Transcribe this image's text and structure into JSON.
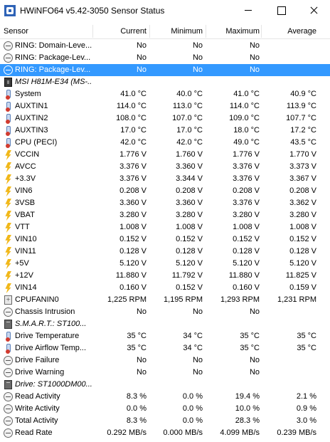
{
  "window": {
    "title": "HWiNFO64 v5.42-3050 Sensor Status"
  },
  "columns": {
    "sensor": "Sensor",
    "current": "Current",
    "minimum": "Minimum",
    "maximum": "Maximum",
    "average": "Average"
  },
  "colors": {
    "selection": "#3399ff",
    "bolt": "#f1b81a",
    "thermometer_bulb": "#d23b2f"
  },
  "rows": [
    {
      "icon": "clock-icon",
      "name": "RING: Domain-Leve...",
      "current": "No",
      "minimum": "No",
      "maximum": "No",
      "average": ""
    },
    {
      "icon": "clock-icon",
      "name": "RING: Package-Lev...",
      "current": "No",
      "minimum": "No",
      "maximum": "No",
      "average": ""
    },
    {
      "icon": "clock-icon",
      "name": "RING: Package-Lev...",
      "current": "No",
      "minimum": "No",
      "maximum": "No",
      "average": "",
      "selected": true
    },
    {
      "icon": "chip-icon",
      "name": "MSI H81M-E34 (MS-...",
      "group": true,
      "current": "",
      "minimum": "",
      "maximum": "",
      "average": ""
    },
    {
      "icon": "thermometer-icon",
      "name": "System",
      "current": "41.0 °C",
      "minimum": "40.0 °C",
      "maximum": "41.0 °C",
      "average": "40.9 °C"
    },
    {
      "icon": "thermometer-icon",
      "name": "AUXTIN1",
      "current": "114.0 °C",
      "minimum": "113.0 °C",
      "maximum": "114.0 °C",
      "average": "113.9 °C"
    },
    {
      "icon": "thermometer-icon",
      "name": "AUXTIN2",
      "current": "108.0 °C",
      "minimum": "107.0 °C",
      "maximum": "109.0 °C",
      "average": "107.7 °C"
    },
    {
      "icon": "thermometer-icon",
      "name": "AUXTIN3",
      "current": "17.0 °C",
      "minimum": "17.0 °C",
      "maximum": "18.0 °C",
      "average": "17.2 °C"
    },
    {
      "icon": "thermometer-icon",
      "name": "CPU (PECI)",
      "current": "42.0 °C",
      "minimum": "42.0 °C",
      "maximum": "49.0 °C",
      "average": "43.5 °C"
    },
    {
      "icon": "lightning-icon",
      "name": "VCCIN",
      "current": "1.776 V",
      "minimum": "1.760 V",
      "maximum": "1.776 V",
      "average": "1.770 V"
    },
    {
      "icon": "lightning-icon",
      "name": "AVCC",
      "current": "3.376 V",
      "minimum": "3.360 V",
      "maximum": "3.376 V",
      "average": "3.373 V"
    },
    {
      "icon": "lightning-icon",
      "name": "+3.3V",
      "current": "3.376 V",
      "minimum": "3.344 V",
      "maximum": "3.376 V",
      "average": "3.367 V"
    },
    {
      "icon": "lightning-icon",
      "name": "VIN6",
      "current": "0.208 V",
      "minimum": "0.208 V",
      "maximum": "0.208 V",
      "average": "0.208 V"
    },
    {
      "icon": "lightning-icon",
      "name": "3VSB",
      "current": "3.360 V",
      "minimum": "3.360 V",
      "maximum": "3.376 V",
      "average": "3.362 V"
    },
    {
      "icon": "lightning-icon",
      "name": "VBAT",
      "current": "3.280 V",
      "minimum": "3.280 V",
      "maximum": "3.280 V",
      "average": "3.280 V"
    },
    {
      "icon": "lightning-icon",
      "name": "VTT",
      "current": "1.008 V",
      "minimum": "1.008 V",
      "maximum": "1.008 V",
      "average": "1.008 V"
    },
    {
      "icon": "lightning-icon",
      "name": "VIN10",
      "current": "0.152 V",
      "minimum": "0.152 V",
      "maximum": "0.152 V",
      "average": "0.152 V"
    },
    {
      "icon": "lightning-icon",
      "name": "VIN11",
      "current": "0.128 V",
      "minimum": "0.128 V",
      "maximum": "0.128 V",
      "average": "0.128 V"
    },
    {
      "icon": "lightning-icon",
      "name": "+5V",
      "current": "5.120 V",
      "minimum": "5.120 V",
      "maximum": "5.120 V",
      "average": "5.120 V"
    },
    {
      "icon": "lightning-icon",
      "name": "+12V",
      "current": "11.880 V",
      "minimum": "11.792 V",
      "maximum": "11.880 V",
      "average": "11.825 V"
    },
    {
      "icon": "lightning-icon",
      "name": "VIN14",
      "current": "0.160 V",
      "minimum": "0.152 V",
      "maximum": "0.160 V",
      "average": "0.159 V"
    },
    {
      "icon": "fan-icon",
      "name": "CPUFANIN0",
      "current": "1,225 RPM",
      "minimum": "1,195 RPM",
      "maximum": "1,293 RPM",
      "average": "1,231 RPM"
    },
    {
      "icon": "clock-icon",
      "name": "Chassis Intrusion",
      "current": "No",
      "minimum": "No",
      "maximum": "No",
      "average": ""
    },
    {
      "icon": "drive-icon",
      "name": "S.M.A.R.T.: ST100...",
      "group": true,
      "current": "",
      "minimum": "",
      "maximum": "",
      "average": ""
    },
    {
      "icon": "thermometer-icon",
      "name": "Drive Temperature",
      "current": "35 °C",
      "minimum": "34 °C",
      "maximum": "35 °C",
      "average": "35 °C"
    },
    {
      "icon": "thermometer-icon",
      "name": "Drive Airflow Temp...",
      "current": "35 °C",
      "minimum": "34 °C",
      "maximum": "35 °C",
      "average": "35 °C"
    },
    {
      "icon": "clock-icon",
      "name": "Drive Failure",
      "current": "No",
      "minimum": "No",
      "maximum": "No",
      "average": ""
    },
    {
      "icon": "clock-icon",
      "name": "Drive Warning",
      "current": "No",
      "minimum": "No",
      "maximum": "No",
      "average": ""
    },
    {
      "icon": "drive-icon",
      "name": "Drive: ST1000DM00...",
      "group": true,
      "current": "",
      "minimum": "",
      "maximum": "",
      "average": ""
    },
    {
      "icon": "clock-icon",
      "name": "Read Activity",
      "current": "8.3 %",
      "minimum": "0.0 %",
      "maximum": "19.4 %",
      "average": "2.1 %"
    },
    {
      "icon": "clock-icon",
      "name": "Write Activity",
      "current": "0.0 %",
      "minimum": "0.0 %",
      "maximum": "10.0 %",
      "average": "0.9 %"
    },
    {
      "icon": "clock-icon",
      "name": "Total Activity",
      "current": "8.3 %",
      "minimum": "0.0 %",
      "maximum": "28.3 %",
      "average": "3.0 %"
    },
    {
      "icon": "clock-icon",
      "name": "Read Rate",
      "current": "0.292 MB/s",
      "minimum": "0.000 MB/s",
      "maximum": "4.099 MB/s",
      "average": "0.239 MB/s"
    }
  ]
}
